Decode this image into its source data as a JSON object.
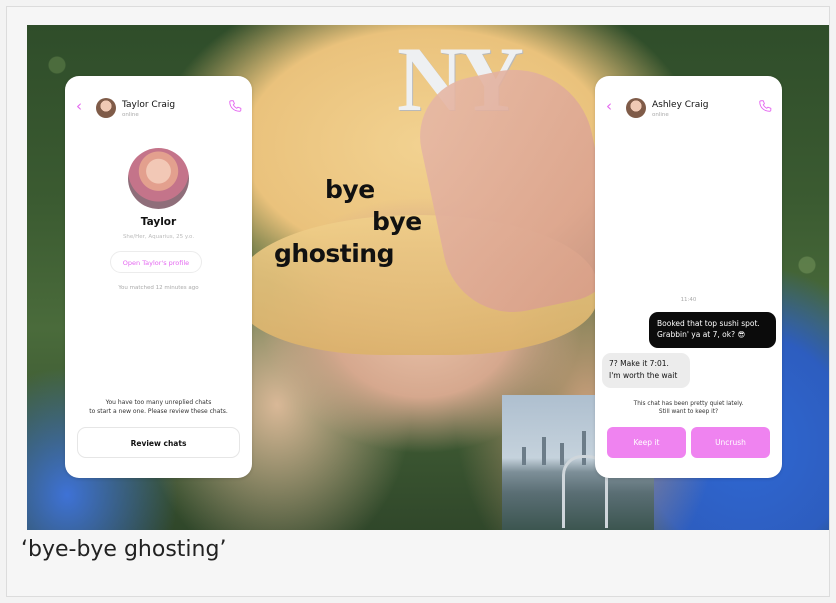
{
  "caption": "‘bye-bye ghosting’",
  "overlay": {
    "line1": "bye",
    "line2": "bye",
    "line3": "ghosting",
    "cap_logo": "NY"
  },
  "left_phone": {
    "back_icon": "chevron-left-icon",
    "contact_name": "Taylor Craig",
    "contact_status": "online",
    "call_icon": "phone-icon",
    "profile_name": "Taylor",
    "profile_meta": "She/Her, Aquarius, 25 y.o.",
    "open_profile_label": "Open Taylor's profile",
    "matched_text": "You matched 12 minutes ago",
    "warning_line1": "You have too many unreplied chats",
    "warning_line2": "to start a new one. Please review these chats.",
    "review_button": "Review chats"
  },
  "right_phone": {
    "back_icon": "chevron-left-icon",
    "contact_name": "Ashley Craig",
    "contact_status": "online",
    "call_icon": "phone-icon",
    "timestamp": "11:40",
    "outgoing_line1": "Booked that top sushi spot.",
    "outgoing_line2": "Grabbin' ya at 7, ok? 😎",
    "incoming_line1": "7? Make it 7:01.",
    "incoming_line2": "I'm worth the wait",
    "quiet_line1": "This chat has been pretty quiet lately.",
    "quiet_line2": "Still want to keep it?",
    "keep_button": "Keep it",
    "uncrush_button": "Uncrush"
  },
  "colors": {
    "accent": "#E467F0",
    "button_fill": "#EF83F0",
    "bubble_dark": "#0B0B0B"
  }
}
